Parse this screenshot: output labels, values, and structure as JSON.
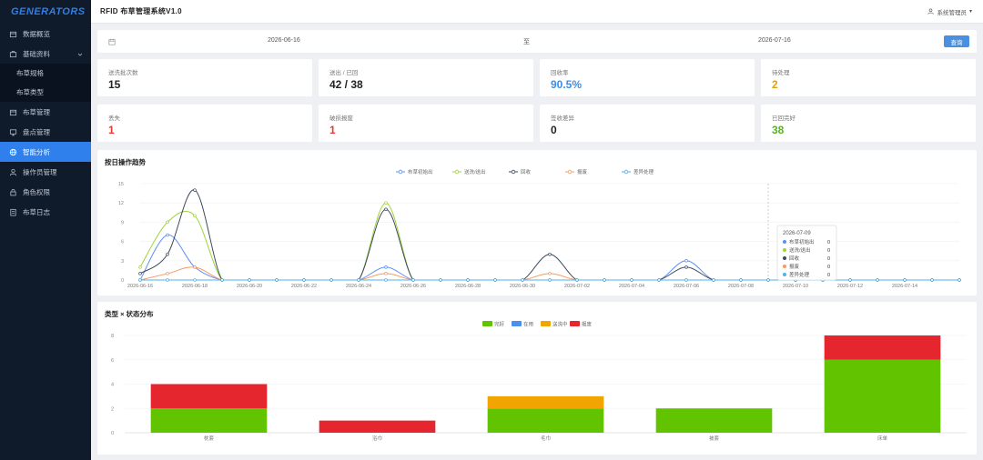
{
  "sidebar": {
    "logo": "GENERATORS",
    "items": [
      {
        "label": "数据概览",
        "icon": "box-icon",
        "name": "sidebar-item-overview",
        "active": false
      },
      {
        "label": "基础资料",
        "icon": "cabinet-icon",
        "name": "sidebar-item-basic-data",
        "active": false,
        "expandable": true
      },
      {
        "label": "布草规格",
        "sub": true,
        "name": "sidebar-item-linen-spec",
        "active": false
      },
      {
        "label": "布草类型",
        "sub": true,
        "name": "sidebar-item-linen-type",
        "active": false
      },
      {
        "label": "布草管理",
        "icon": "box-icon",
        "name": "sidebar-item-linen-manage",
        "active": false
      },
      {
        "label": "盘点管理",
        "icon": "monitor-icon",
        "name": "sidebar-item-inventory",
        "active": false
      },
      {
        "label": "智能分析",
        "icon": "globe-icon",
        "name": "sidebar-item-analysis",
        "active": true
      },
      {
        "label": "操作员管理",
        "icon": "user-icon",
        "name": "sidebar-item-operators",
        "active": false
      },
      {
        "label": "角色权限",
        "icon": "lock-icon",
        "name": "sidebar-item-roles",
        "active": false
      },
      {
        "label": "布草日志",
        "icon": "doc-icon",
        "name": "sidebar-item-logs",
        "active": false
      }
    ]
  },
  "header": {
    "title": "RFID 布草管理系统V1.0",
    "user": "系统管理员"
  },
  "date_filter": {
    "start": "2026-06-16",
    "separator": "至",
    "end": "2026-07-16",
    "query_label": "查询"
  },
  "stats": [
    {
      "label": "送洗批次数",
      "value": "15",
      "color": "#222222"
    },
    {
      "label": "送出 / 已回",
      "value": "42 / 38",
      "color": "#222222"
    },
    {
      "label": "回收率",
      "value": "90.5%",
      "color": "#3b8ee8"
    },
    {
      "label": "待处理",
      "value": "2",
      "color": "#e6a100"
    },
    {
      "label": "丢失",
      "value": "1",
      "color": "#e53935"
    },
    {
      "label": "破损报废",
      "value": "1",
      "color": "#e53935"
    },
    {
      "label": "签收差异",
      "value": "0",
      "color": "#222222"
    },
    {
      "label": "已回完好",
      "value": "38",
      "color": "#55b51b"
    }
  ],
  "trend": {
    "title": "按日操作趋势",
    "tooltip": {
      "date": "2026-07-09",
      "rows": [
        {
          "label": "布草初始出",
          "value": "0"
        },
        {
          "label": "送洗/送出",
          "value": "0"
        },
        {
          "label": "回收",
          "value": "0"
        },
        {
          "label": "报废",
          "value": "0"
        },
        {
          "label": "差异处理",
          "value": "0"
        }
      ]
    }
  },
  "dist": {
    "title": "类型 × 状态分布"
  },
  "chart_data": [
    {
      "type": "line",
      "title": "按日操作趋势",
      "x": [
        "2026-06-16",
        "2026-06-17",
        "2026-06-18",
        "2026-06-19",
        "2026-06-20",
        "2026-06-21",
        "2026-06-22",
        "2026-06-23",
        "2026-06-24",
        "2026-06-25",
        "2026-06-26",
        "2026-06-27",
        "2026-06-28",
        "2026-06-29",
        "2026-06-30",
        "2026-07-01",
        "2026-07-02",
        "2026-07-03",
        "2026-07-04",
        "2026-07-05",
        "2026-07-06",
        "2026-07-07",
        "2026-07-08",
        "2026-07-09",
        "2026-07-10",
        "2026-07-11",
        "2026-07-12",
        "2026-07-13",
        "2026-07-14",
        "2026-07-15",
        "2026-07-16"
      ],
      "x_tick_labels": [
        "2026-06-16",
        "2026-06-18",
        "2026-06-20",
        "2026-06-22",
        "2026-06-24",
        "2026-06-26",
        "2026-06-28",
        "2026-06-30",
        "2026-07-02",
        "2026-07-04",
        "2026-07-06",
        "2026-07-08",
        "2026-07-10",
        "2026-07-12",
        "2026-07-14"
      ],
      "ylim": [
        0,
        15
      ],
      "yticks": [
        0,
        3,
        6,
        9,
        12,
        15
      ],
      "legend": "top-center",
      "series": [
        {
          "name": "布草初始出",
          "color": "#5b8ff9",
          "values": [
            0,
            7,
            2,
            0,
            0,
            0,
            0,
            0,
            0,
            2,
            0,
            0,
            0,
            0,
            0,
            0,
            0,
            0,
            0,
            0,
            3,
            0,
            0,
            0,
            0,
            0,
            0,
            0,
            0,
            0,
            0
          ]
        },
        {
          "name": "送洗/送出",
          "color": "#9fd43c",
          "values": [
            2,
            9,
            10,
            0,
            0,
            0,
            0,
            0,
            0,
            12,
            0,
            0,
            0,
            0,
            0,
            0,
            0,
            0,
            0,
            0,
            0,
            0,
            0,
            0,
            0,
            0,
            0,
            0,
            0,
            0,
            0
          ]
        },
        {
          "name": "回收",
          "color": "#3d4a5c",
          "values": [
            1,
            4,
            14,
            0,
            0,
            0,
            0,
            0,
            0,
            11,
            0,
            0,
            0,
            0,
            0,
            4,
            0,
            0,
            0,
            0,
            2,
            0,
            0,
            0,
            0,
            0,
            0,
            0,
            0,
            0,
            0
          ]
        },
        {
          "name": "报废",
          "color": "#f59a62",
          "values": [
            0,
            1,
            2,
            0,
            0,
            0,
            0,
            0,
            0,
            1,
            0,
            0,
            0,
            0,
            0,
            1,
            0,
            0,
            0,
            0,
            0,
            0,
            0,
            0,
            0,
            0,
            0,
            0,
            0,
            0,
            0
          ]
        },
        {
          "name": "差异处理",
          "color": "#4fb3e8",
          "values": [
            0,
            0,
            0,
            0,
            0,
            0,
            0,
            0,
            0,
            0,
            0,
            0,
            0,
            0,
            0,
            0,
            0,
            0,
            0,
            0,
            0,
            0,
            0,
            0,
            0,
            0,
            0,
            0,
            0,
            0,
            0
          ]
        }
      ]
    },
    {
      "type": "bar",
      "stacked": true,
      "title": "类型 × 状态分布",
      "categories": [
        "枕套",
        "浴巾",
        "毛巾",
        "被套",
        "床单"
      ],
      "ylim": [
        0,
        8
      ],
      "yticks": [
        0,
        2,
        4,
        6,
        8
      ],
      "legend": "top-center",
      "series": [
        {
          "name": "完好",
          "color": "#62c300",
          "values": [
            2,
            0,
            2,
            2,
            6
          ]
        },
        {
          "name": "在用",
          "color": "#4d8ff0",
          "values": [
            0,
            0,
            0,
            0,
            0
          ]
        },
        {
          "name": "送洗中",
          "color": "#f2a500",
          "values": [
            0,
            0,
            1,
            0,
            0
          ]
        },
        {
          "name": "报废",
          "color": "#e6262e",
          "values": [
            2,
            1,
            0,
            0,
            2
          ]
        }
      ]
    }
  ]
}
